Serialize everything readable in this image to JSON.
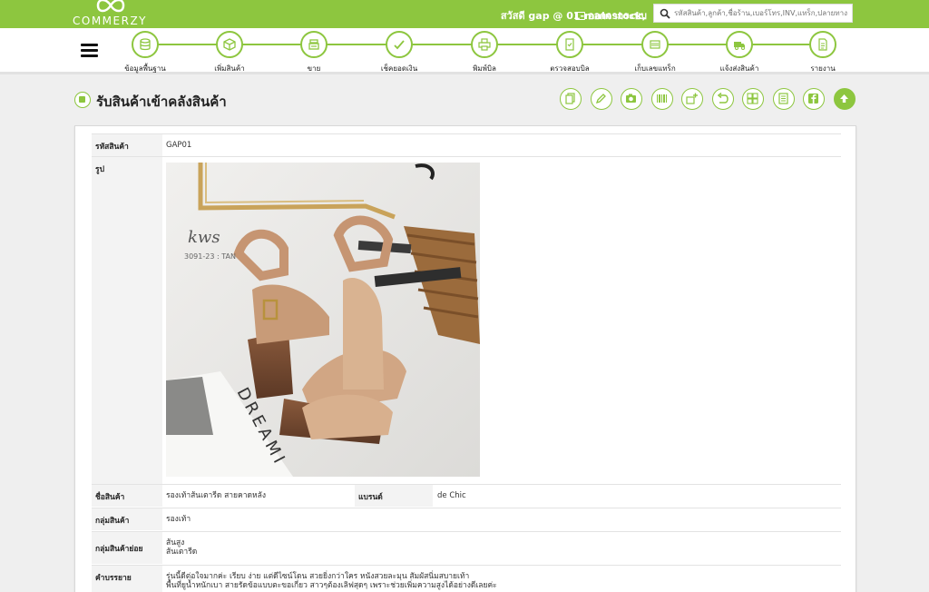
{
  "header": {
    "logo_text": "COMMERZY",
    "greeting": "สวัสดี gap @ 01-mainstock,",
    "logout_label": "ออกจากระบบ",
    "search_placeholder": "รหัสสินค้า,ลูกค้า,ชื่อร้าน,เบอร์โทร,INV,แทร็ก,ปลายทาง",
    "accent_color": "#8dc63f"
  },
  "nav": {
    "items": [
      {
        "label": "ข้อมูลพื้นฐาน",
        "icon": "database-icon"
      },
      {
        "label": "เพิ่มสินค้า",
        "icon": "box-icon"
      },
      {
        "label": "ขาย",
        "icon": "cash-register-icon"
      },
      {
        "label": "เช็คยอดเงิน",
        "icon": "money-check-icon"
      },
      {
        "label": "พิมพ์บิล",
        "icon": "printer-icon"
      },
      {
        "label": "ตรวจสอบบิล",
        "icon": "bill-check-icon"
      },
      {
        "label": "เก็บเลขแทร็ก",
        "icon": "tracking-icon"
      },
      {
        "label": "แจ้งส่งสินค้า",
        "icon": "truck-icon"
      },
      {
        "label": "รายงาน",
        "icon": "report-icon"
      }
    ]
  },
  "page": {
    "title": "รับสินค้าเข้าคลังสินค้า",
    "toolbar_icons": [
      "copy-icon",
      "edit-icon",
      "camera-icon",
      "barcode-icon",
      "add-stock-icon",
      "undo-icon",
      "grid-icon",
      "list-icon",
      "facebook-icon",
      "upload-icon"
    ]
  },
  "product": {
    "code_label": "รหัสสินค้า",
    "code": "GAP01",
    "image_label": "รูป",
    "image_caption_brand": "kws",
    "image_caption_sku": "3091-23 : TAN",
    "image_magazine_text": "DREAMI",
    "name_label": "ชื่อสินค้า",
    "name": "รองเท้าส้นเตารีด สายคาดหลัง",
    "brand_label": "แบรนด์",
    "brand": "de Chic",
    "group_label": "กลุ่มสินค้า",
    "group": "รองเท้า",
    "subgroup_label": "กลุ่มสินค้าย่อย",
    "subgroup_line1": "ส้นสูง",
    "subgroup_line2": "ส้นเตารีด",
    "description_label": "คำบรรยาย",
    "description_line1": "รุ่นนี้ดีต่อใจมากค่ะ เรียบ ง่าย แต่ดีไซน์โดน สวยยิ่งกว่าใคร  หนังสวยละมุน สัมผัสนิ่มสบายเท้า",
    "description_line2": "พื้นที่ยูน้ำหนักเบา สายรัดข้อแบบตะขอเกี่ยว สาวๆต้องเลิฟสุดๆ เพราะช่วยเพิ่มความสูงได้อย่างดีเลยค่ะ"
  }
}
